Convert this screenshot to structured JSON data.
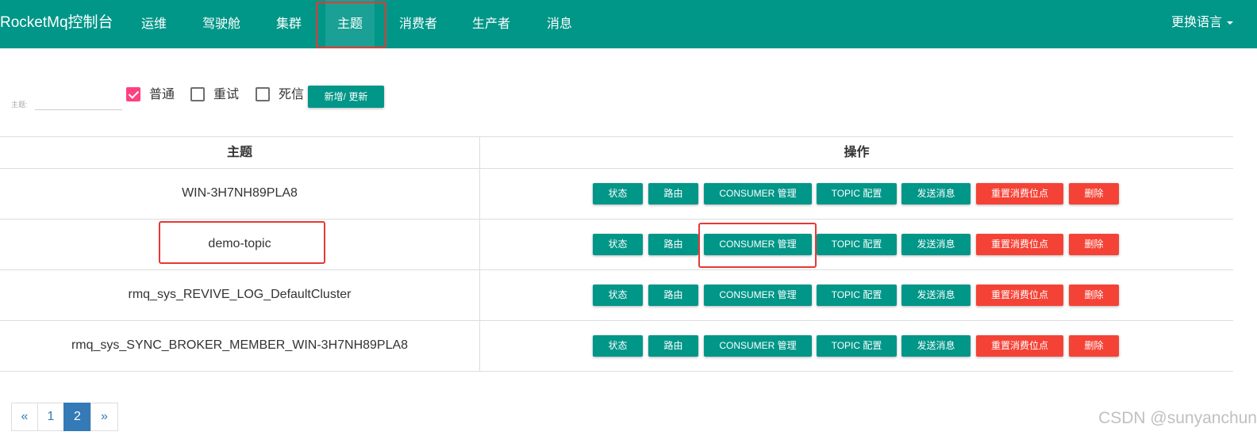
{
  "nav": {
    "brand": "RocketMq控制台",
    "items": [
      "运维",
      "驾驶舱",
      "集群",
      "主题",
      "消费者",
      "生产者",
      "消息"
    ],
    "active": "主题",
    "language": "更换语言"
  },
  "filter": {
    "topic_label": "主题:",
    "topic_value": "",
    "checkboxes": [
      {
        "label": "普通",
        "checked": true
      },
      {
        "label": "重试",
        "checked": false
      },
      {
        "label": "死信",
        "checked": false
      }
    ],
    "add_button": "新增/ 更新"
  },
  "table": {
    "headers": [
      "主题",
      "操作"
    ],
    "rows": [
      "WIN-3H7NH89PLA8",
      "demo-topic",
      "rmq_sys_REVIVE_LOG_DefaultCluster",
      "rmq_sys_SYNC_BROKER_MEMBER_WIN-3H7NH89PLA8"
    ],
    "actions": [
      {
        "label": "状态",
        "color": "#009688"
      },
      {
        "label": "路由",
        "color": "#009688"
      },
      {
        "label": "CONSUMER 管理",
        "color": "#009688"
      },
      {
        "label": "TOPIC 配置",
        "color": "#009688"
      },
      {
        "label": "发送消息",
        "color": "#009688"
      },
      {
        "label": "重置消费位点",
        "color": "#f44336"
      },
      {
        "label": "删除",
        "color": "#f44336"
      }
    ]
  },
  "pagination": {
    "prev": "«",
    "pages": [
      "1",
      "2"
    ],
    "current": "2",
    "next": "»"
  },
  "watermark": "CSDN @sunyanchun",
  "colors": {
    "primary": "#009688",
    "danger": "#f44336",
    "checkbox_checked": "#ff4081",
    "pagination_active": "#337ab7",
    "highlight_box": "#e53935"
  }
}
